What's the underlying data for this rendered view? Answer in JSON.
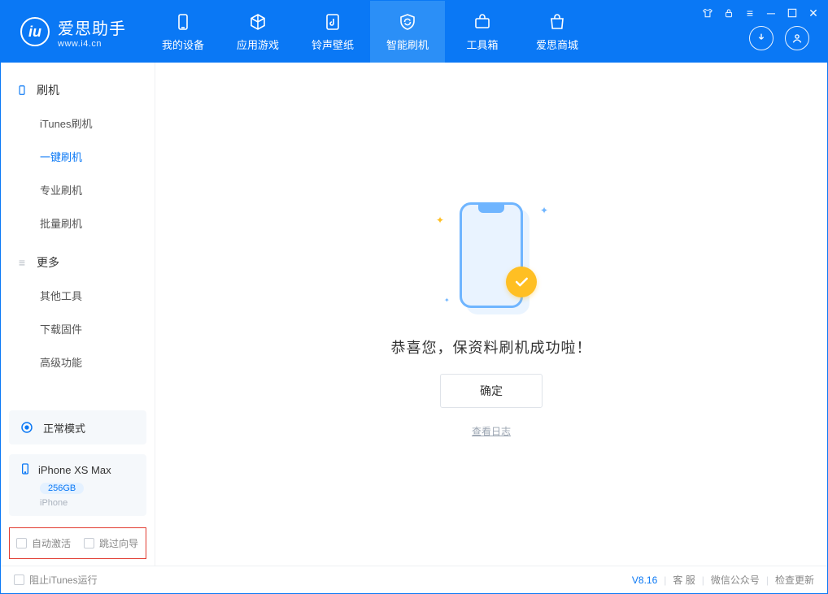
{
  "brand": {
    "name": "爱思助手",
    "url": "www.i4.cn"
  },
  "nav": {
    "items": [
      {
        "label": "我的设备"
      },
      {
        "label": "应用游戏"
      },
      {
        "label": "铃声壁纸"
      },
      {
        "label": "智能刷机"
      },
      {
        "label": "工具箱"
      },
      {
        "label": "爱思商城"
      }
    ],
    "active_index": 3
  },
  "sidebar": {
    "section1": {
      "title": "刷机"
    },
    "items1": [
      {
        "label": "iTunes刷机"
      },
      {
        "label": "一键刷机"
      },
      {
        "label": "专业刷机"
      },
      {
        "label": "批量刷机"
      }
    ],
    "active1_index": 1,
    "section2": {
      "title": "更多"
    },
    "items2": [
      {
        "label": "其他工具"
      },
      {
        "label": "下载固件"
      },
      {
        "label": "高级功能"
      }
    ],
    "mode_card": {
      "label": "正常模式"
    },
    "device": {
      "name": "iPhone XS Max",
      "capacity": "256GB",
      "type": "iPhone"
    },
    "options": {
      "auto_activate": "自动激活",
      "skip_guide": "跳过向导"
    }
  },
  "main": {
    "success_message": "恭喜您，保资料刷机成功啦！",
    "ok_button": "确定",
    "view_log": "查看日志"
  },
  "statusbar": {
    "block_itunes": "阻止iTunes运行",
    "version": "V8.16",
    "links": {
      "support": "客 服",
      "wechat": "微信公众号",
      "update": "检查更新"
    }
  }
}
